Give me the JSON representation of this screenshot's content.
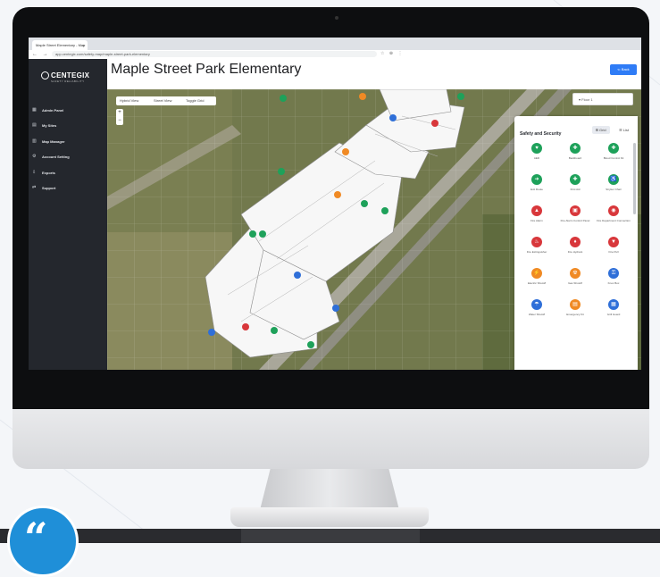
{
  "browser": {
    "tab_title": "Maple Street Elementary - Map",
    "tab_close": "×",
    "nav_buttons": "← → ⟳",
    "url": "app.centegix.com/safety-map/maple-street-park-elementary",
    "addr_icons": "☆ ⊕ ⋮"
  },
  "brand": {
    "name": "CENTEGIX",
    "tagline": "SAFETY RELIABILITY"
  },
  "sidebar": {
    "items": [
      {
        "icon": "▦",
        "label": "Admin Panel"
      },
      {
        "icon": "▤",
        "label": "My Sites"
      },
      {
        "icon": "▥",
        "label": "Map Manager"
      },
      {
        "icon": "⚙",
        "label": "Account Setting"
      },
      {
        "icon": "⇩",
        "label": "Exports"
      },
      {
        "icon": "⇄",
        "label": "Support"
      }
    ]
  },
  "main": {
    "title": "Maple Street Park Elementary",
    "back_label": "⇐ Back"
  },
  "map": {
    "toolbar": [
      "Hybrid View",
      "Street View",
      "Toggle Grid"
    ],
    "zoom_in": "+",
    "zoom_out": "−",
    "floor_select": "▾ Floor 1"
  },
  "panel": {
    "tabs": [
      "⊞ Grid",
      "☰ List"
    ],
    "heading": "Safety and Security",
    "items": [
      {
        "label": "AED",
        "icon": "♥",
        "color": "#1ea15a"
      },
      {
        "label": "Backboard",
        "icon": "✚",
        "color": "#1ea15a"
      },
      {
        "label": "Blood Control Kit",
        "icon": "✚",
        "color": "#1ea15a"
      },
      {
        "label": "Exit Route",
        "icon": "➜",
        "color": "#1ea15a"
      },
      {
        "label": "First Aid",
        "icon": "✚",
        "color": "#1ea15a"
      },
      {
        "label": "Stryker Chair",
        "icon": "♿",
        "color": "#1ea15a"
      },
      {
        "label": "Fire Alarm",
        "icon": "▲",
        "color": "#d8373b"
      },
      {
        "label": "Fire Alarm Control Panel",
        "icon": "▣",
        "color": "#d8373b"
      },
      {
        "label": "Fire Department Connection",
        "icon": "◉",
        "color": "#d8373b"
      },
      {
        "label": "Fire Extinguisher",
        "icon": "♨",
        "color": "#d8373b"
      },
      {
        "label": "Fire Hydrant",
        "icon": "♦",
        "color": "#d8373b"
      },
      {
        "label": "Fire Pull",
        "icon": "▼",
        "color": "#d8373b"
      },
      {
        "label": "Electric Shutoff",
        "icon": "⚡",
        "color": "#f08a24"
      },
      {
        "label": "Gas Shutoff",
        "icon": "☢",
        "color": "#f08a24"
      },
      {
        "label": "Knox Box",
        "icon": "⚿",
        "color": "#2f6fd8"
      },
      {
        "label": "Water Shutoff",
        "icon": "☂",
        "color": "#2f6fd8"
      },
      {
        "label": "Emergency Kit",
        "icon": "▤",
        "color": "#f08a24"
      },
      {
        "label": "Grill Guard",
        "icon": "▦",
        "color": "#2f6fd8"
      }
    ]
  },
  "badge": {
    "glyph": "“"
  }
}
